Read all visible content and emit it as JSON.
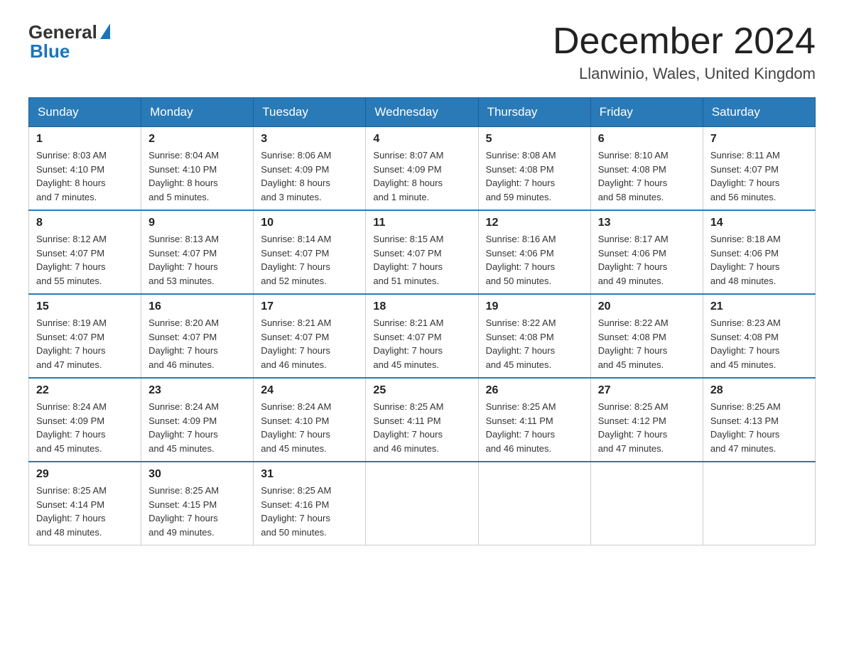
{
  "header": {
    "logo_general": "General",
    "logo_blue": "Blue",
    "month_title": "December 2024",
    "location": "Llanwinio, Wales, United Kingdom"
  },
  "weekdays": [
    "Sunday",
    "Monday",
    "Tuesday",
    "Wednesday",
    "Thursday",
    "Friday",
    "Saturday"
  ],
  "weeks": [
    [
      {
        "day": "1",
        "sunrise": "8:03 AM",
        "sunset": "4:10 PM",
        "daylight": "8 hours and 7 minutes."
      },
      {
        "day": "2",
        "sunrise": "8:04 AM",
        "sunset": "4:10 PM",
        "daylight": "8 hours and 5 minutes."
      },
      {
        "day": "3",
        "sunrise": "8:06 AM",
        "sunset": "4:09 PM",
        "daylight": "8 hours and 3 minutes."
      },
      {
        "day": "4",
        "sunrise": "8:07 AM",
        "sunset": "4:09 PM",
        "daylight": "8 hours and 1 minute."
      },
      {
        "day": "5",
        "sunrise": "8:08 AM",
        "sunset": "4:08 PM",
        "daylight": "7 hours and 59 minutes."
      },
      {
        "day": "6",
        "sunrise": "8:10 AM",
        "sunset": "4:08 PM",
        "daylight": "7 hours and 58 minutes."
      },
      {
        "day": "7",
        "sunrise": "8:11 AM",
        "sunset": "4:07 PM",
        "daylight": "7 hours and 56 minutes."
      }
    ],
    [
      {
        "day": "8",
        "sunrise": "8:12 AM",
        "sunset": "4:07 PM",
        "daylight": "7 hours and 55 minutes."
      },
      {
        "day": "9",
        "sunrise": "8:13 AM",
        "sunset": "4:07 PM",
        "daylight": "7 hours and 53 minutes."
      },
      {
        "day": "10",
        "sunrise": "8:14 AM",
        "sunset": "4:07 PM",
        "daylight": "7 hours and 52 minutes."
      },
      {
        "day": "11",
        "sunrise": "8:15 AM",
        "sunset": "4:07 PM",
        "daylight": "7 hours and 51 minutes."
      },
      {
        "day": "12",
        "sunrise": "8:16 AM",
        "sunset": "4:06 PM",
        "daylight": "7 hours and 50 minutes."
      },
      {
        "day": "13",
        "sunrise": "8:17 AM",
        "sunset": "4:06 PM",
        "daylight": "7 hours and 49 minutes."
      },
      {
        "day": "14",
        "sunrise": "8:18 AM",
        "sunset": "4:06 PM",
        "daylight": "7 hours and 48 minutes."
      }
    ],
    [
      {
        "day": "15",
        "sunrise": "8:19 AM",
        "sunset": "4:07 PM",
        "daylight": "7 hours and 47 minutes."
      },
      {
        "day": "16",
        "sunrise": "8:20 AM",
        "sunset": "4:07 PM",
        "daylight": "7 hours and 46 minutes."
      },
      {
        "day": "17",
        "sunrise": "8:21 AM",
        "sunset": "4:07 PM",
        "daylight": "7 hours and 46 minutes."
      },
      {
        "day": "18",
        "sunrise": "8:21 AM",
        "sunset": "4:07 PM",
        "daylight": "7 hours and 45 minutes."
      },
      {
        "day": "19",
        "sunrise": "8:22 AM",
        "sunset": "4:08 PM",
        "daylight": "7 hours and 45 minutes."
      },
      {
        "day": "20",
        "sunrise": "8:22 AM",
        "sunset": "4:08 PM",
        "daylight": "7 hours and 45 minutes."
      },
      {
        "day": "21",
        "sunrise": "8:23 AM",
        "sunset": "4:08 PM",
        "daylight": "7 hours and 45 minutes."
      }
    ],
    [
      {
        "day": "22",
        "sunrise": "8:24 AM",
        "sunset": "4:09 PM",
        "daylight": "7 hours and 45 minutes."
      },
      {
        "day": "23",
        "sunrise": "8:24 AM",
        "sunset": "4:09 PM",
        "daylight": "7 hours and 45 minutes."
      },
      {
        "day": "24",
        "sunrise": "8:24 AM",
        "sunset": "4:10 PM",
        "daylight": "7 hours and 45 minutes."
      },
      {
        "day": "25",
        "sunrise": "8:25 AM",
        "sunset": "4:11 PM",
        "daylight": "7 hours and 46 minutes."
      },
      {
        "day": "26",
        "sunrise": "8:25 AM",
        "sunset": "4:11 PM",
        "daylight": "7 hours and 46 minutes."
      },
      {
        "day": "27",
        "sunrise": "8:25 AM",
        "sunset": "4:12 PM",
        "daylight": "7 hours and 47 minutes."
      },
      {
        "day": "28",
        "sunrise": "8:25 AM",
        "sunset": "4:13 PM",
        "daylight": "7 hours and 47 minutes."
      }
    ],
    [
      {
        "day": "29",
        "sunrise": "8:25 AM",
        "sunset": "4:14 PM",
        "daylight": "7 hours and 48 minutes."
      },
      {
        "day": "30",
        "sunrise": "8:25 AM",
        "sunset": "4:15 PM",
        "daylight": "7 hours and 49 minutes."
      },
      {
        "day": "31",
        "sunrise": "8:25 AM",
        "sunset": "4:16 PM",
        "daylight": "7 hours and 50 minutes."
      },
      null,
      null,
      null,
      null
    ]
  ],
  "labels": {
    "sunrise": "Sunrise:",
    "sunset": "Sunset:",
    "daylight": "Daylight:"
  }
}
